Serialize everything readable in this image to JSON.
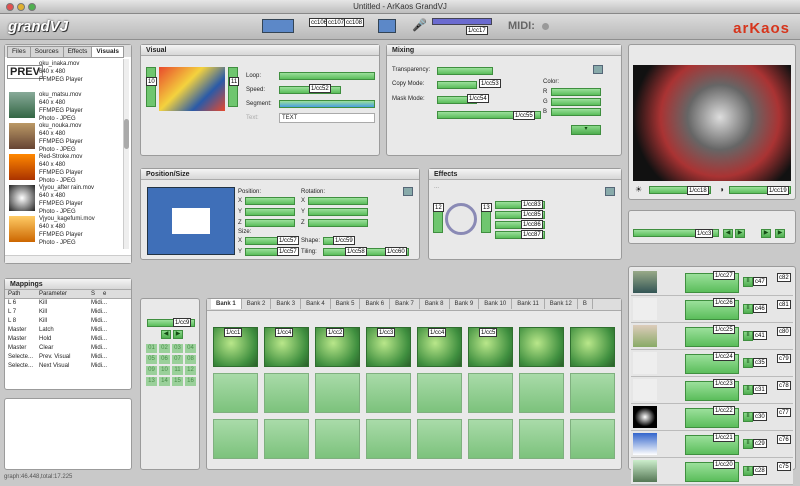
{
  "window": {
    "title": "Untitled - ArKaos GrandVJ"
  },
  "toolbar": {
    "logo": "grandVJ",
    "cc1": "cc106",
    "cc2": "cc107",
    "cc3": "cc108",
    "midi": "MIDI:",
    "cc4": "1/cc17",
    "brand": "arKaos"
  },
  "browser": {
    "tabs": [
      "Files",
      "Sources",
      "Effects",
      "Visuals"
    ],
    "prev": "PREV",
    "items": [
      {
        "name": "oku_inaka.mov",
        "l2": "640 x 480",
        "l3": "FFMPEG Player",
        "l4": "Photo - JPEG"
      },
      {
        "name": "oku_matsu.mov",
        "l2": "640 x 480",
        "l3": "FFMPEG Player",
        "l4": "Photo - JPEG"
      },
      {
        "name": "oku_nouka.mov",
        "l2": "640 x 480",
        "l3": "FFMPEG Player",
        "l4": "Photo - JPEG"
      },
      {
        "name": "Red-Stroke.mov",
        "l2": "640 x 480",
        "l3": "FFMPEG Player",
        "l4": "Photo - JPEG"
      },
      {
        "name": "Vjyou_after rain.mov",
        "l2": "640 x 480",
        "l3": "FFMPEG Player",
        "l4": "Photo - JPEG"
      },
      {
        "name": "Vjyou_kagefumi.mov",
        "l2": "640 x 480",
        "l3": "FFMPEG Player",
        "l4": "Photo - JPEG"
      }
    ]
  },
  "mappings": {
    "title": "Mappings",
    "headers": [
      "Path",
      "Parameter",
      "S",
      "e"
    ],
    "rows": [
      [
        "L 6",
        "Kill",
        "Midi..."
      ],
      [
        "L 7",
        "Kill",
        "Midi..."
      ],
      [
        "L 8",
        "Kill",
        "Midi..."
      ],
      [
        "Master",
        "Latch",
        "Midi..."
      ],
      [
        "Master",
        "Hold",
        "Midi..."
      ],
      [
        "Master",
        "Clear",
        "Midi..."
      ],
      [
        "Selecte...",
        "Prev. Visual",
        "Midi..."
      ],
      [
        "Selecte...",
        "Next Visual",
        "Midi..."
      ]
    ]
  },
  "status": {
    "text": "graph:46.448,total:17.225"
  },
  "visual": {
    "title": "Visual",
    "left_num": "10",
    "right_num": "11",
    "loop": "Loop:",
    "speed": "Speed:",
    "speed_cc": "1/cc52",
    "segment": "Segment:",
    "text_label": "Text:",
    "text_value": "TEXT"
  },
  "mixing": {
    "title": "Mixing",
    "transparency": "Transparency:",
    "copy": "Copy Mode:",
    "copy_cc": "1/cc53",
    "mask": "Mask Mode:",
    "mask_cc": "1/cc54",
    "mask_cc2": "1/cc55",
    "color": "Color:",
    "r": "R",
    "g": "G",
    "b": "B"
  },
  "preview": {
    "cc18": "1/cc18",
    "cc19": "1/cc19",
    "cc3": "1/cc3"
  },
  "position": {
    "title": "Position/Size",
    "position": "Position:",
    "rotation": "Rotation:",
    "size": "Size:",
    "x": "X",
    "y": "Y",
    "z": "Z",
    "shape": "Shape:",
    "tiling": "Tiling:",
    "cc57": "1/cc57",
    "cc59": "1/cc59",
    "cc57b": "1/cc57",
    "cc58": "1/cc58",
    "cc60": "1/cc60"
  },
  "effects": {
    "title": "Effects",
    "placeholder": "...",
    "n12": "12",
    "n13": "13",
    "cc": [
      "1/cc83",
      "1/cc85",
      "1/cc86",
      "1/cc87"
    ]
  },
  "bankctl": {
    "cc9": "1/cc9",
    "nums": [
      "01",
      "02",
      "03",
      "04",
      "05",
      "06",
      "07",
      "08",
      "09",
      "10",
      "11",
      "12",
      "13",
      "14",
      "15",
      "16"
    ]
  },
  "banks": {
    "tabs": [
      "Bank 1",
      "Bank 2",
      "Bank 3",
      "Bank 4",
      "Bank 5",
      "Bank 6",
      "Bank 7",
      "Bank 8",
      "Bank 9",
      "Bank 10",
      "Bank 11",
      "Bank 12",
      "B"
    ],
    "cells": [
      "1/cc1",
      "1/cc4",
      "1/cc2",
      "1/cc3",
      "1/cc4",
      "1/cc5",
      "",
      ""
    ]
  },
  "layers": [
    {
      "cc": "1/cc27",
      "c1": "c47",
      "c2": "c82"
    },
    {
      "cc": "1/cc26",
      "c1": "c46",
      "c2": "c81"
    },
    {
      "cc": "1/cc25",
      "c1": "c41",
      "c2": "c80"
    },
    {
      "cc": "1/cc24",
      "c1": "c35",
      "c2": "c79"
    },
    {
      "cc": "1/cc23",
      "c1": "c31",
      "c2": "c78"
    },
    {
      "cc": "1/cc22",
      "c1": "c30",
      "c2": "c77"
    },
    {
      "cc": "1/cc21",
      "c1": "c29",
      "c2": "c76"
    },
    {
      "cc": "1/cc20",
      "c1": "c28",
      "c2": "c75"
    }
  ]
}
